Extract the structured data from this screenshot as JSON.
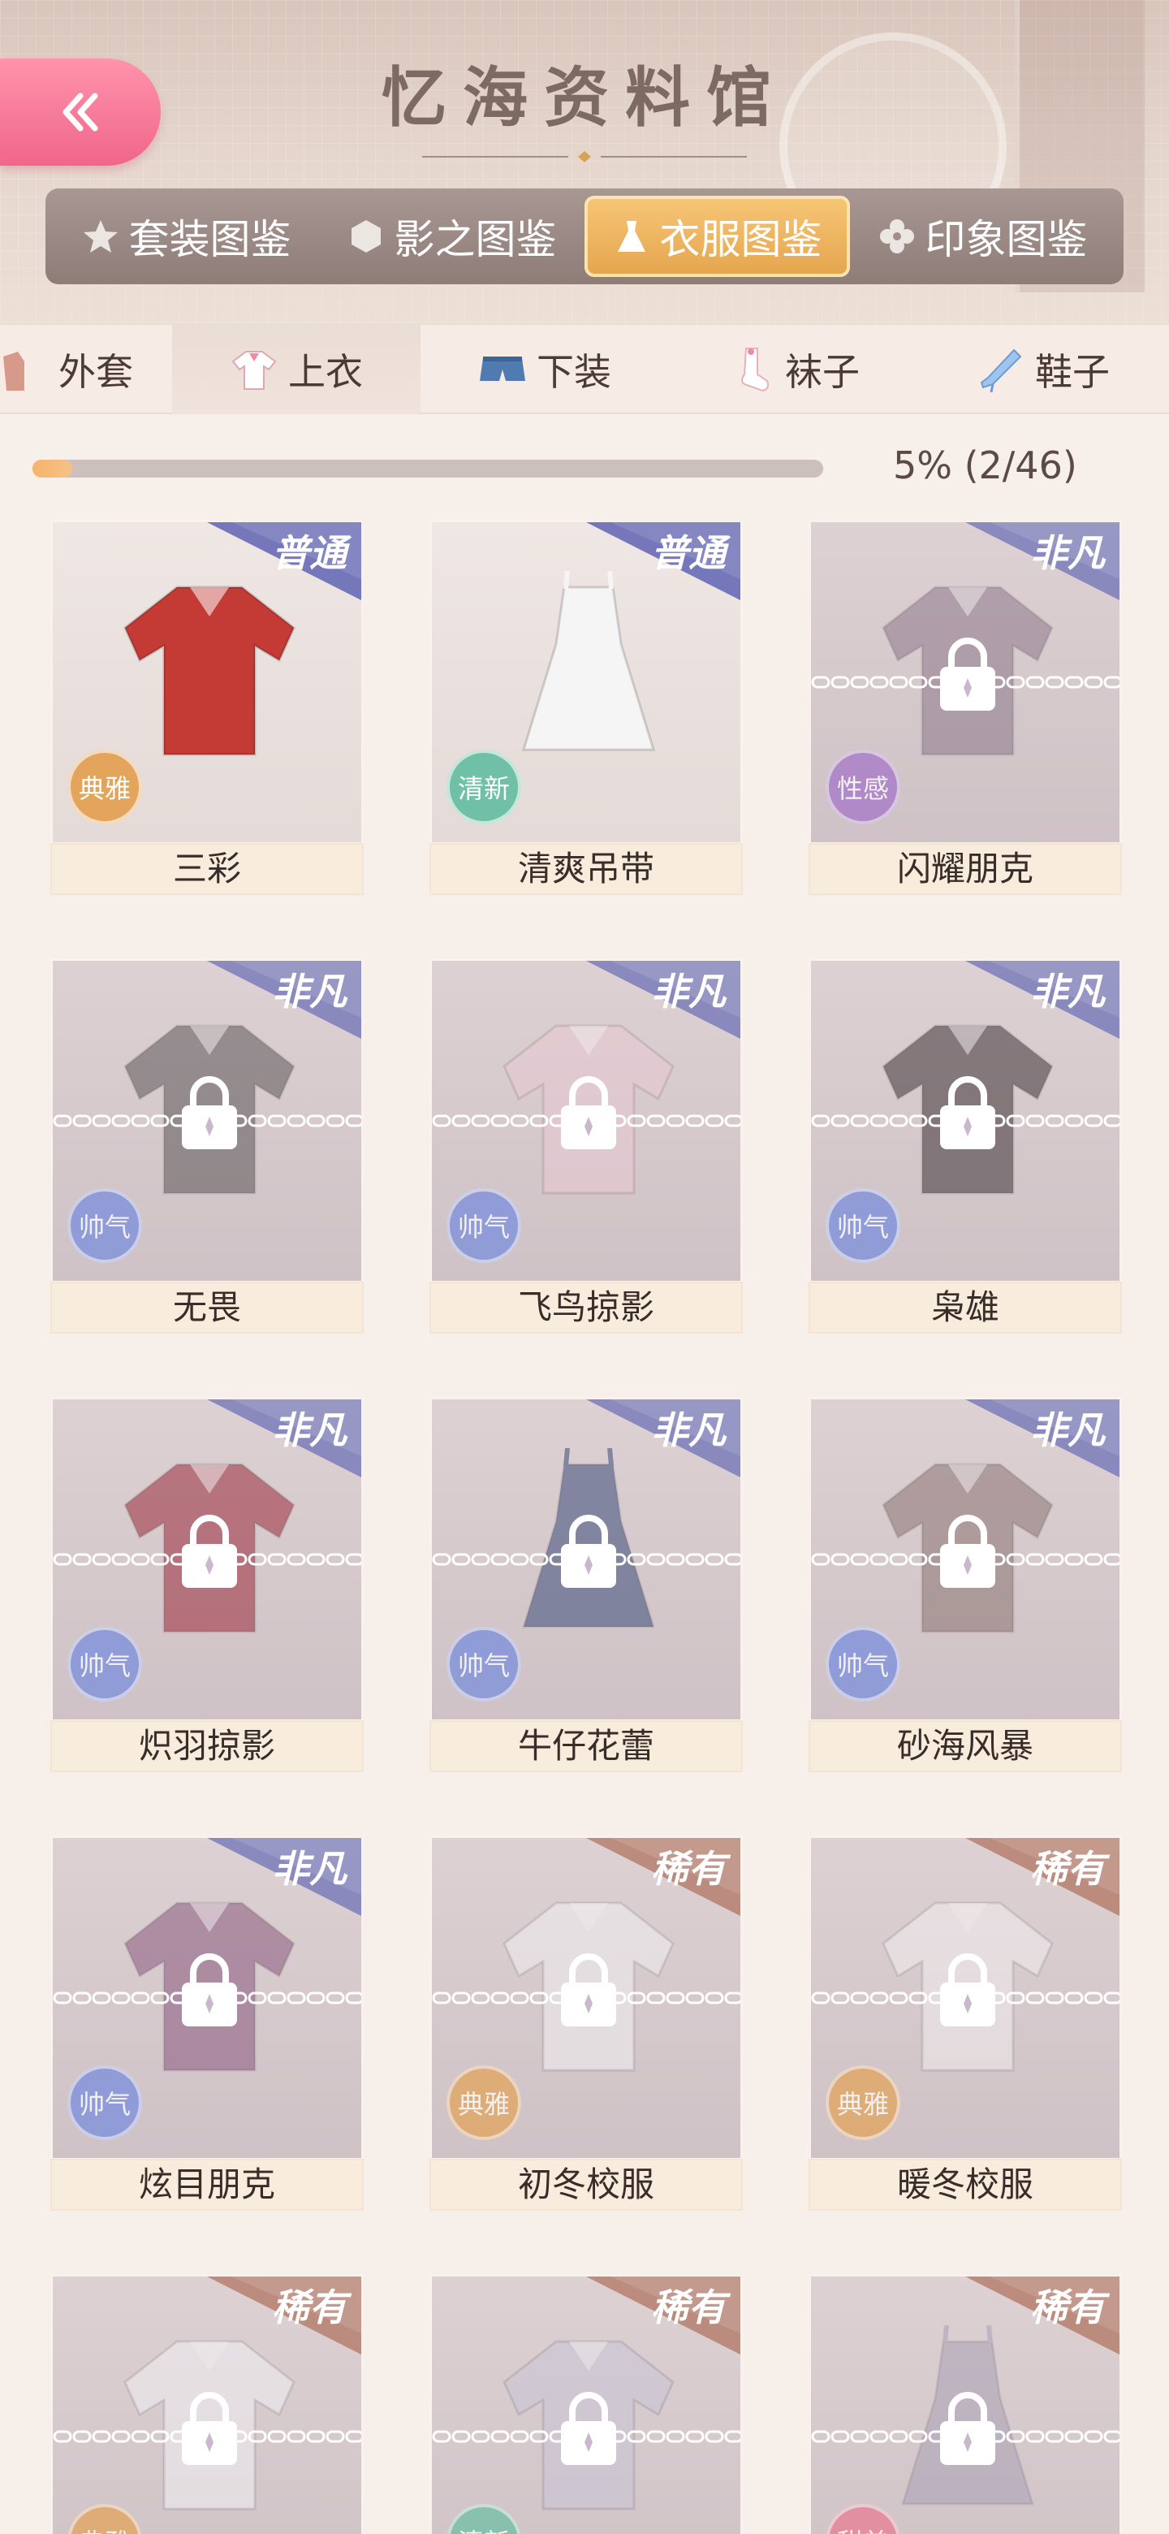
{
  "header": {
    "title": "忆海资料馆",
    "back_icon": "double-chevron-left-icon",
    "tabs": [
      {
        "label": "套装图鉴",
        "icon": "star-icon",
        "active": false
      },
      {
        "label": "影之图鉴",
        "icon": "hexagon-icon",
        "active": false
      },
      {
        "label": "衣服图鉴",
        "icon": "dress-icon",
        "active": true
      },
      {
        "label": "印象图鉴",
        "icon": "flower-icon",
        "active": false
      }
    ]
  },
  "categories": [
    {
      "label": "外套",
      "icon": "coat-icon",
      "active": false
    },
    {
      "label": "上衣",
      "icon": "shirt-icon",
      "active": true
    },
    {
      "label": "下装",
      "icon": "shorts-icon",
      "active": false
    },
    {
      "label": "袜子",
      "icon": "sock-icon",
      "active": false
    },
    {
      "label": "鞋子",
      "icon": "heel-shoe-icon",
      "active": false
    }
  ],
  "progress": {
    "text": "5% (2/46)",
    "fraction": 0.05
  },
  "colors": {
    "accent_pink": "#f0668a",
    "accent_gold": "#e5a44d",
    "rarity_common": "#6e71b7",
    "rarity_rare": "#b06a5a"
  },
  "items": [
    {
      "name": "三彩",
      "rarity": "普通",
      "style": "典雅",
      "locked": false,
      "garment": "red-shirt"
    },
    {
      "name": "清爽吊带",
      "rarity": "普通",
      "style": "清新",
      "locked": false,
      "garment": "white-camisole"
    },
    {
      "name": "闪耀朋克",
      "rarity": "非凡",
      "style": "性感",
      "locked": true,
      "garment": "lace-top"
    },
    {
      "name": "无畏",
      "rarity": "非凡",
      "style": "帅气",
      "locked": true,
      "garment": "grey-jacket"
    },
    {
      "name": "飞鸟掠影",
      "rarity": "非凡",
      "style": "帅气",
      "locked": true,
      "garment": "pink-blouse"
    },
    {
      "name": "枭雄",
      "rarity": "非凡",
      "style": "帅气",
      "locked": true,
      "garment": "dark-jacket"
    },
    {
      "name": "炽羽掠影",
      "rarity": "非凡",
      "style": "帅气",
      "locked": true,
      "garment": "red-sweater"
    },
    {
      "name": "牛仔花蕾",
      "rarity": "非凡",
      "style": "帅气",
      "locked": true,
      "garment": "denim-dress"
    },
    {
      "name": "砂海风暴",
      "rarity": "非凡",
      "style": "帅气",
      "locked": true,
      "garment": "lace-top-brown"
    },
    {
      "name": "炫目朋克",
      "rarity": "非凡",
      "style": "帅气",
      "locked": true,
      "garment": "lace-top-purple"
    },
    {
      "name": "初冬校服",
      "rarity": "稀有",
      "style": "典雅",
      "locked": true,
      "garment": "school-vest"
    },
    {
      "name": "暖冬校服",
      "rarity": "稀有",
      "style": "典雅",
      "locked": true,
      "garment": "school-vest-red"
    },
    {
      "name": "",
      "rarity": "稀有",
      "style": "典雅",
      "locked": true,
      "garment": "white-shirt-bow"
    },
    {
      "name": "",
      "rarity": "稀有",
      "style": "清新",
      "locked": true,
      "garment": "plaid-shirt"
    },
    {
      "name": "",
      "rarity": "稀有",
      "style": "甜美",
      "locked": true,
      "garment": "plaid-dress"
    }
  ]
}
